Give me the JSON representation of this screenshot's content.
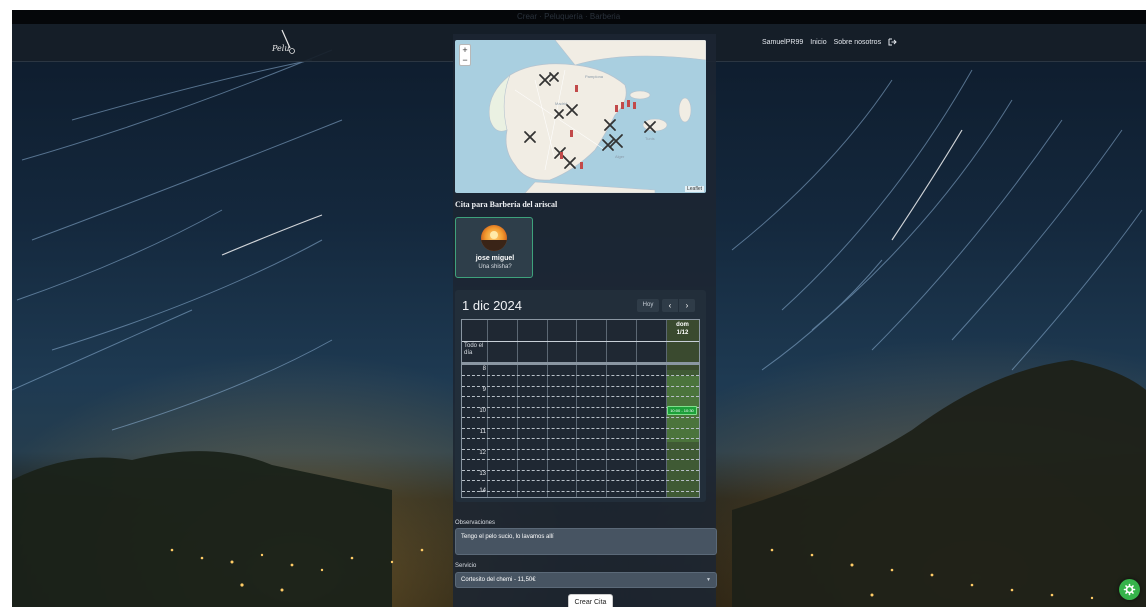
{
  "window": {
    "title": "Crear · Peluquería · Barberia"
  },
  "navbar": {
    "logo_text": "Pelu",
    "username": "SamuelPR99",
    "link_home": "Inicio",
    "link_about": "Sobre nosotros",
    "logout_icon": "logout-icon"
  },
  "map": {
    "zoom_in": "+",
    "zoom_out": "−",
    "attribution": "Leaflet",
    "marker_icon": "scissors-icon",
    "water_color": "#a9cfe0",
    "land_color": "#f1ede4"
  },
  "booking": {
    "title": "Cita para Barbería del ariscal",
    "barber": {
      "name": "jose miguel",
      "description": "Una shisha?"
    }
  },
  "calendar": {
    "title": "1 dic 2024",
    "today_button": "Hoy",
    "prev_icon": "chevron-left-icon",
    "next_icon": "chevron-right-icon",
    "all_day_label": "Todo el día",
    "day_header_weekday": "dom",
    "day_header_date": "1/12",
    "hours": [
      "8",
      "9",
      "10",
      "11",
      "12",
      "13",
      "14"
    ],
    "event_label": "10:00 - 10:30",
    "highlight_color": "#1da03a"
  },
  "form": {
    "observaciones_label": "Observaciones",
    "observaciones_value": "Tengo el pelo sucio, lo lavamos allí",
    "servicio_label": "Servicio",
    "servicio_value": "Cortesito del chemi - 11,50€",
    "submit_label": "Crear Cita"
  },
  "floating": {
    "settings_icon": "gear-icon",
    "color": "#36b34a"
  }
}
